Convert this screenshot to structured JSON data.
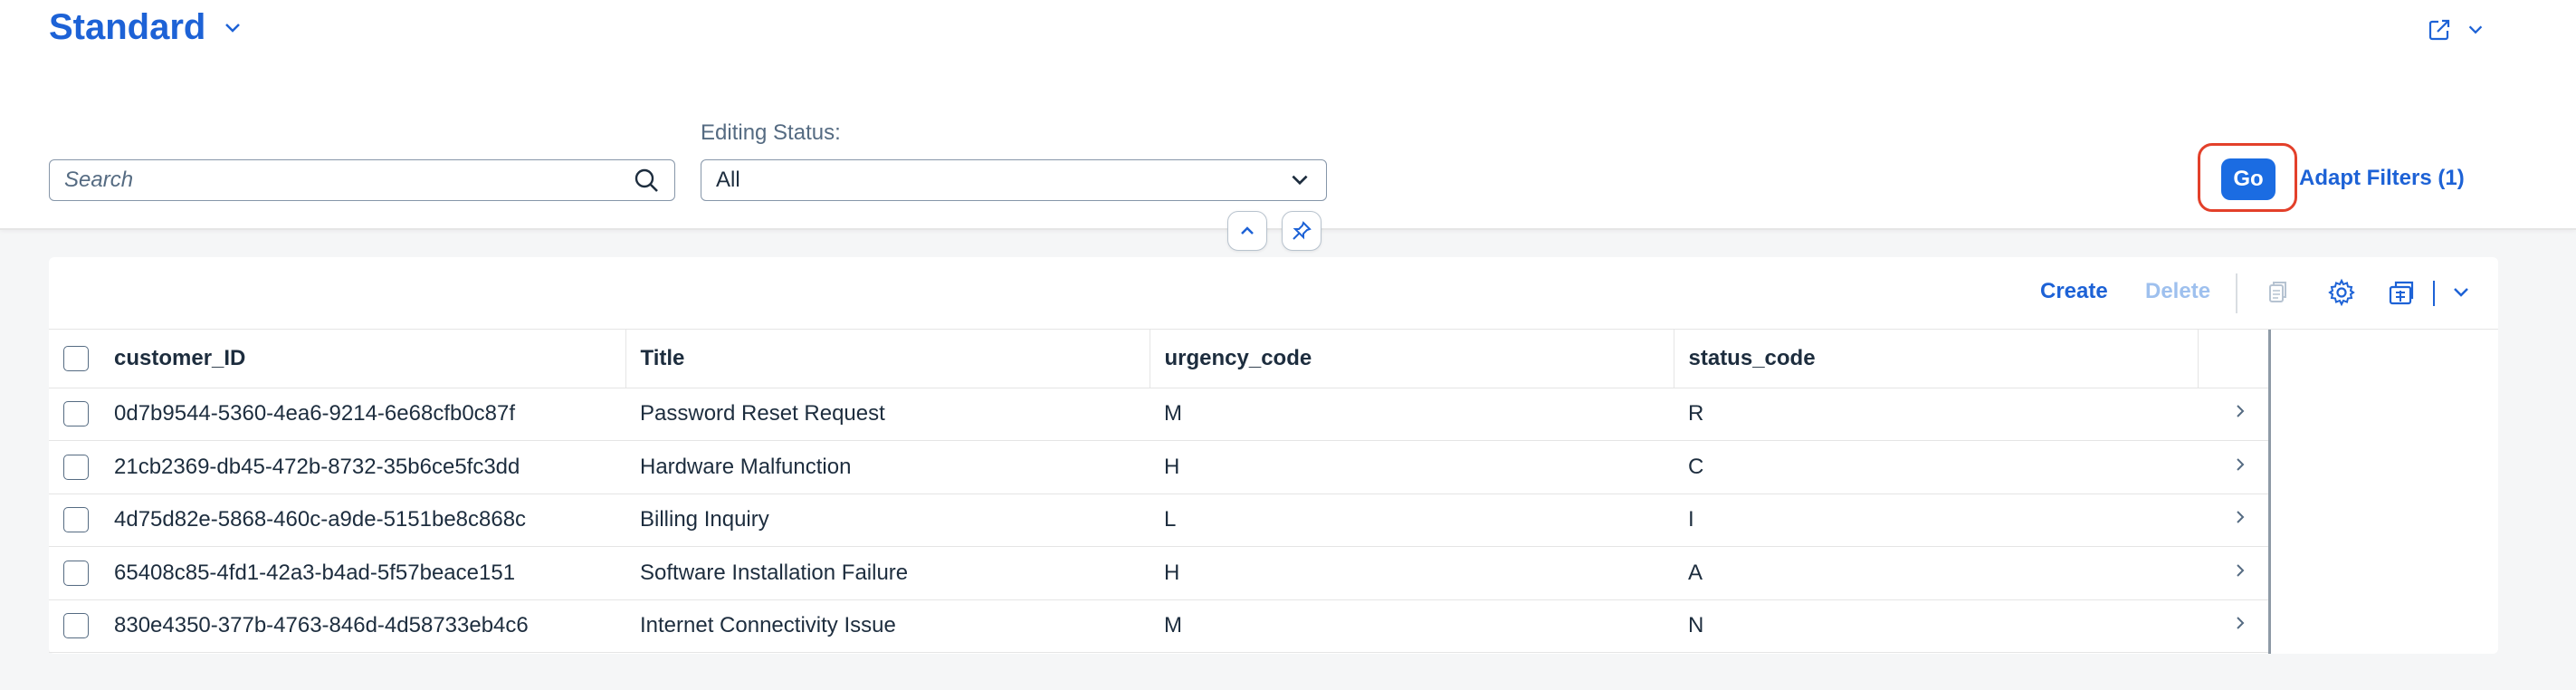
{
  "header": {
    "variant_title": "Standard",
    "filter_label": "Editing Status:",
    "search_placeholder": "Search",
    "editing_status_value": "All",
    "go_label": "Go",
    "adapt_filters_label": "Adapt Filters (1)"
  },
  "toolbar": {
    "create_label": "Create",
    "delete_label": "Delete"
  },
  "table": {
    "columns": [
      "customer_ID",
      "Title",
      "urgency_code",
      "status_code"
    ],
    "rows": [
      [
        "0d7b9544-5360-4ea6-9214-6e68cfb0c87f",
        "Password Reset Request",
        "M",
        "R"
      ],
      [
        "21cb2369-db45-472b-8732-35b6ce5fc3dd",
        "Hardware Malfunction",
        "H",
        "C"
      ],
      [
        "4d75d82e-5868-460c-a9de-5151be8c868c",
        "Billing Inquiry",
        "L",
        "I"
      ],
      [
        "65408c85-4fd1-42a3-b4ad-5f57beace151",
        "Software Installation Failure",
        "H",
        "A"
      ],
      [
        "830e4350-377b-4763-846d-4d58733eb4c6",
        "Internet Connectivity Issue",
        "M",
        "N"
      ]
    ]
  },
  "colors": {
    "accent": "#1d62d6",
    "go_button": "#1b6ce2",
    "highlight": "#e3402a",
    "disabled_link": "#9ec0ee"
  },
  "icons": [
    "chevron-down-icon",
    "share-icon",
    "search-icon",
    "chevron-up-icon",
    "pin-icon",
    "copy-icon",
    "gear-icon",
    "export-icon",
    "chevron-right-icon"
  ]
}
